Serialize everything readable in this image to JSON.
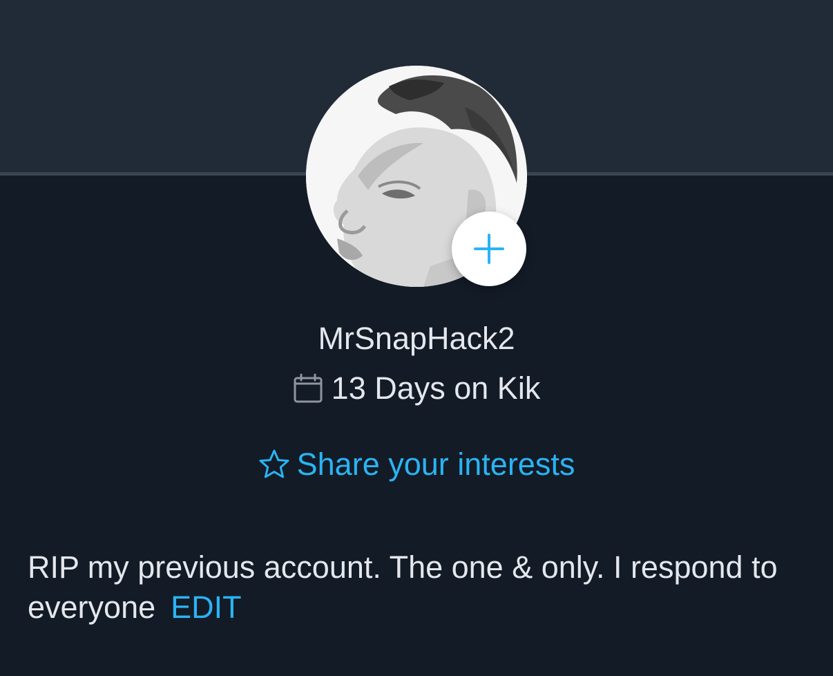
{
  "profile": {
    "username": "MrSnapHack2",
    "days_on_kik": "13 Days on Kik",
    "interests_link": "Share your interests",
    "bio": "RIP my previous account. The one & only. I respond to everyone",
    "edit_label": "EDIT"
  },
  "icons": {
    "add": "plus-icon",
    "calendar": "calendar-icon",
    "interests": "star-icon"
  },
  "colors": {
    "header_bg": "#212a37",
    "content_bg": "#131b27",
    "divider": "#3b4552",
    "text": "#e4e7ec",
    "accent": "#2ab4f3"
  }
}
